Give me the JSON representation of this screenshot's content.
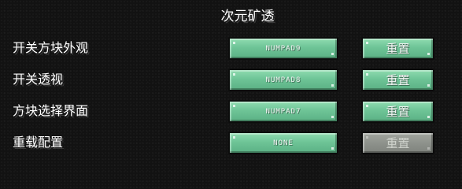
{
  "title": "次元矿透",
  "rows": [
    {
      "label": "开关方块外观",
      "key": "NUMPAD9",
      "reset_label": "重置",
      "reset_enabled": true
    },
    {
      "label": "开关透视",
      "key": "NUMPAD8",
      "reset_label": "重置",
      "reset_enabled": true
    },
    {
      "label": "方块选择界面",
      "key": "NUMPAD7",
      "reset_label": "重置",
      "reset_enabled": true
    },
    {
      "label": "重载配置",
      "key": "NONE",
      "reset_label": "重置",
      "reset_enabled": false
    }
  ],
  "colors": {
    "button_green": "#6ec497",
    "button_disabled": "#8e928c",
    "background": "#121212"
  }
}
